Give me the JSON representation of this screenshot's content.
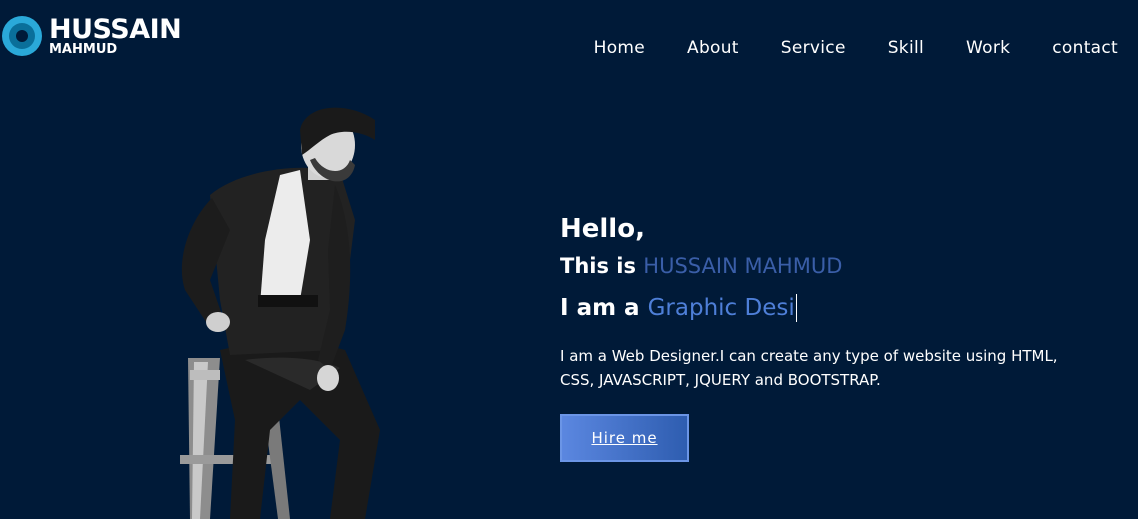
{
  "header": {
    "logo_name": "HUSSAIN",
    "logo_sub": "MAHMUD",
    "nav": [
      "Home",
      "About",
      "Service",
      "Skill",
      "Work",
      "contact"
    ]
  },
  "hero": {
    "greeting": "Hello,",
    "intro_prefix": "This is",
    "intro_name": "HUSSAIN MAHMUD",
    "role_prefix": "I am a",
    "role_typed": "Graphic Desi",
    "description": "I am a Web Designer.I can create any type of website using HTML, CSS, JAVASCRIPT, JQUERY and BOOTSTRAP.",
    "cta_label": "Hire me"
  },
  "colors": {
    "background": "#001a38",
    "accent": "#4e7fd8",
    "name_accent": "#3a5ea8",
    "logo": "#2aa9d9"
  },
  "icons": {
    "logo": "logo-ring-icon"
  }
}
